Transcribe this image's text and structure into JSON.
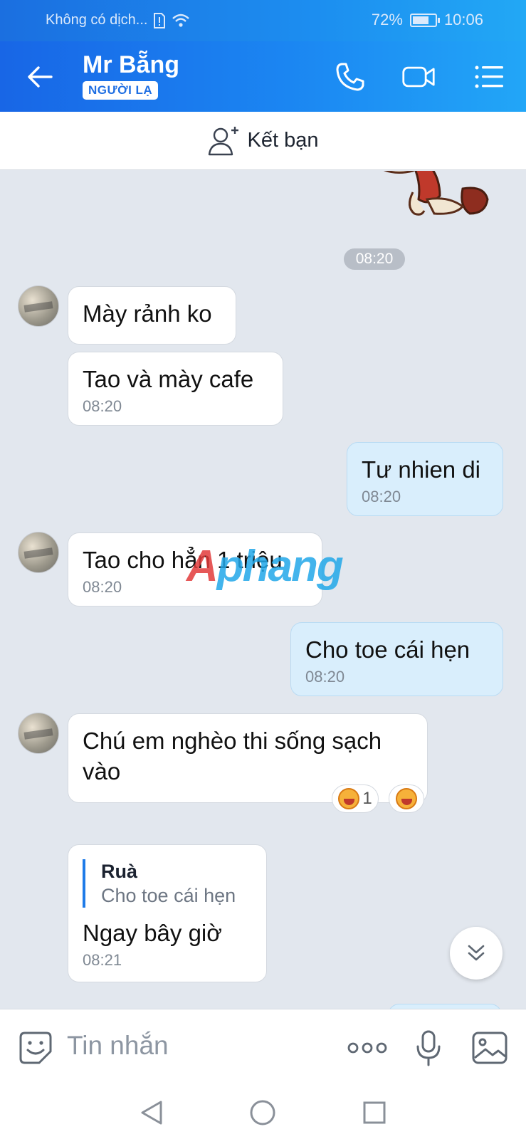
{
  "status_bar": {
    "carrier": "Không có dịch...",
    "battery": "72%",
    "battery_level": 0.72,
    "time": "10:06"
  },
  "header": {
    "contact_name": "Mr Bẵng",
    "badge": "NGƯỜI LẠ"
  },
  "friend_bar": {
    "label": "Kết bạn"
  },
  "chat": {
    "date_pill": "08:20",
    "messages": [
      {
        "dir": "in",
        "text": "Mày rảnh ko",
        "time": ""
      },
      {
        "dir": "in",
        "text": "Tao và mày cafe",
        "time": "08:20"
      },
      {
        "dir": "out",
        "text": "Tư nhien di",
        "time": "08:20"
      },
      {
        "dir": "in",
        "text": "Tao cho hẳn 1 triệu",
        "time": "08:20"
      },
      {
        "dir": "out",
        "text": "Cho toe cái hẹn",
        "time": "08:20"
      },
      {
        "dir": "in",
        "text": "Chú em nghèo thi sống sạch vào",
        "time": ""
      },
      {
        "dir": "in",
        "text": "Ngay bây giờ",
        "time": "08:21",
        "quote": {
          "name": "Ruà",
          "text": "Cho toe cái hẹn"
        }
      }
    ],
    "reaction_count": "1"
  },
  "watermark": {
    "part1": "A",
    "part2": "phang"
  },
  "input": {
    "placeholder": "Tin nhắn"
  }
}
